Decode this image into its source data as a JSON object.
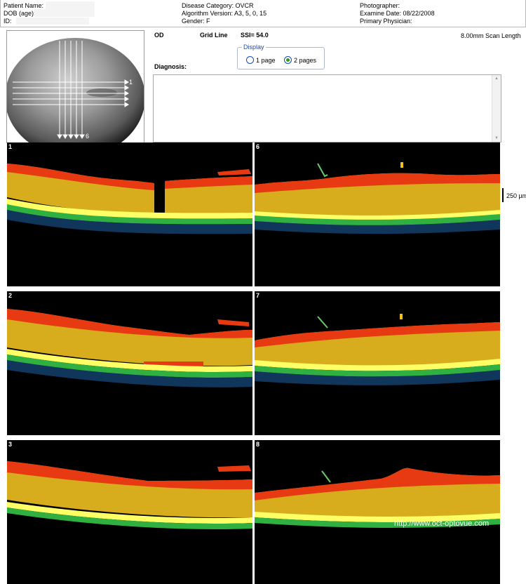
{
  "header": {
    "patient_name_label": "Patient Name:",
    "dob_label": "DOB (age):",
    "id_label": "ID:",
    "disease_category": "Disease Category: OVCR",
    "algorithm_version": "Algorithm Version: A3, 5, 0, 15",
    "gender": "Gender: F",
    "photographer": "Photographer:",
    "examine_date": "Examine Date: 08/22/2008",
    "primary_physician": "Primary Physician:"
  },
  "info": {
    "eye": "OD",
    "scan_type": "Grid Line",
    "ssi": "SSI= 54.0",
    "scan_length": "8.00mm Scan Length",
    "diagnosis_label": "Diagnosis:",
    "diagnosis_text": ""
  },
  "display": {
    "legend": "Display",
    "options": [
      {
        "label": "1 page",
        "selected": false
      },
      {
        "label": "2 pages",
        "selected": true
      }
    ]
  },
  "fundus": {
    "horizontal_marker": "1",
    "vertical_marker": "6"
  },
  "scans": [
    {
      "number": "1"
    },
    {
      "number": "6"
    },
    {
      "number": "2"
    },
    {
      "number": "7"
    },
    {
      "number": "3"
    },
    {
      "number": "8"
    }
  ],
  "scale": {
    "label": "250 µm"
  },
  "watermark": "http://www.oct-optovue.com",
  "colors": {
    "accent": "#1f4aa8",
    "radio_selected": "#2a9a2a",
    "oct_background": "#000000"
  }
}
